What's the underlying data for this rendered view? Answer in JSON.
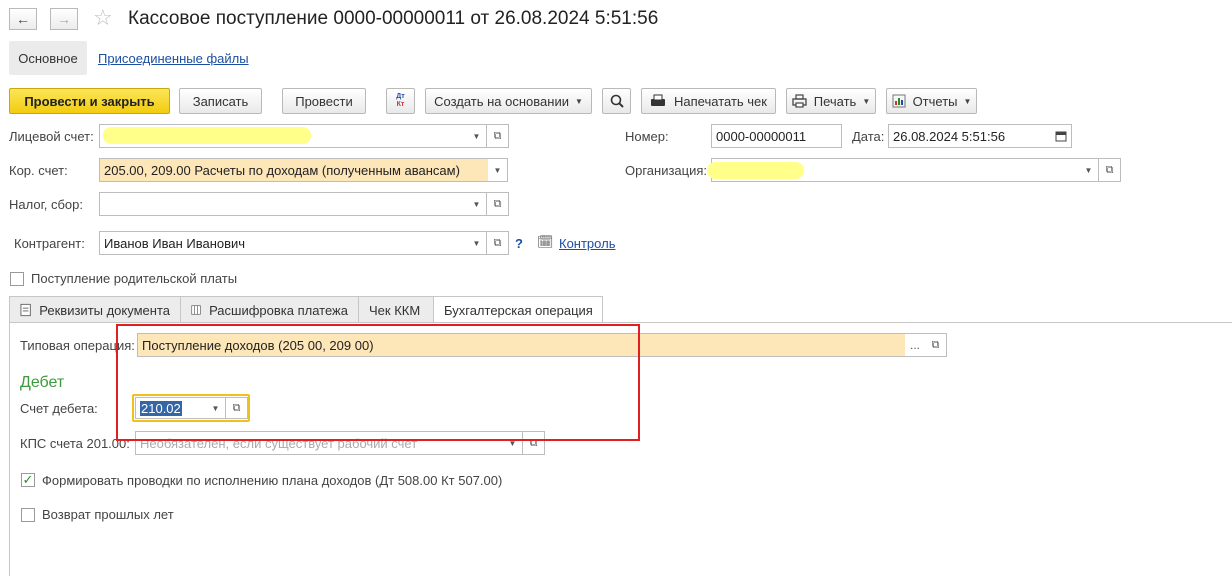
{
  "window": {
    "title": "Кассовое поступление 0000-00000011 от 26.08.2024 5:51:56",
    "back_icon": "arrow-left-icon",
    "forward_icon": "arrow-right-icon",
    "favorite_icon": "star-icon"
  },
  "nav": {
    "main": "Основное",
    "attached": "Присоединенные файлы"
  },
  "toolbar": {
    "post_close": "Провести и закрыть",
    "save": "Записать",
    "post": "Провести",
    "dtkt_top": "Дт",
    "dtkt_bottom": "Кт",
    "create_based": "Создать на основании",
    "print_receipt": "Напечатать чек",
    "print": "Печать",
    "reports": "Отчеты"
  },
  "form": {
    "account_label": "Лицевой счет:",
    "account_value": "",
    "cor_account_label": "Кор. счет:",
    "cor_account_value": "205.00, 209.00 Расчеты по доходам (полученным авансам)",
    "tax_label": "Налог, сбор:",
    "tax_value": "",
    "counterparty_label": "Контрагент:",
    "counterparty_value": "Иванов Иван Иванович",
    "help": "?",
    "control_link": "Контроль",
    "number_label": "Номер:",
    "number_value": "0000-00000011",
    "date_label": "Дата:",
    "date_value": "26.08.2024  5:51:56",
    "org_label": "Организация:",
    "org_value": "",
    "parent_fee_label": "Поступление родительской платы"
  },
  "tabs": [
    {
      "label": "Реквизиты документа"
    },
    {
      "label": "Расшифровка платежа"
    },
    {
      "label": "Чек ККМ"
    },
    {
      "label": "Бухгалтерская операция"
    }
  ],
  "operation": {
    "typical_label": "Типовая операция:",
    "typical_value": "Поступление доходов (205 00, 209 00)",
    "debit_header": "Дебет",
    "debit_account_label": "Счет дебета:",
    "debit_account_value": "210.02",
    "kps_label": "КПС счета 201.00:",
    "kps_placeholder": "Необязателен, если существует рабочий счет",
    "form_entries_label": "Формировать проводки по исполнению плана доходов (Дт 508.00 Кт 507.00)",
    "form_entries_checked": true,
    "prior_years_label": "Возврат прошлых лет",
    "prior_years_checked": false
  },
  "colors": {
    "primary_button": "#f3cc10",
    "highlight_field": "#fde6b8",
    "debit_header": "#3d9a3d",
    "annotation_red": "#e02020",
    "link": "#1c4fa3"
  }
}
